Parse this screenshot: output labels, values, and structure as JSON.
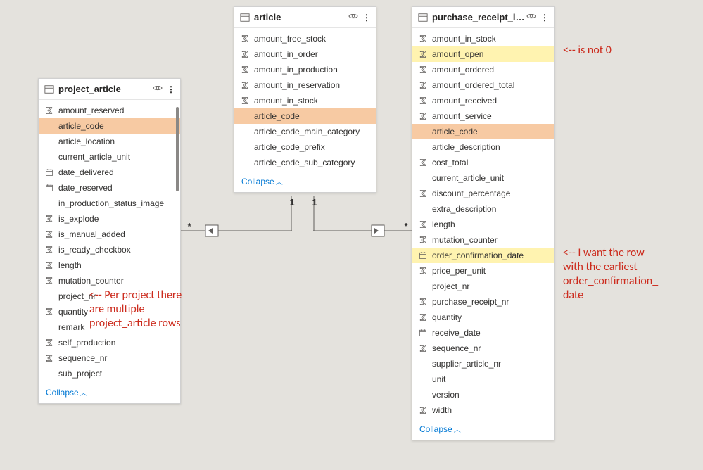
{
  "tables": {
    "project_article": {
      "title": "project_article",
      "collapse": "Collapse",
      "fields": [
        {
          "icon": "sum",
          "label": "amount_reserved",
          "hl": null
        },
        {
          "icon": "none",
          "label": "article_code",
          "hl": "orange"
        },
        {
          "icon": "none",
          "label": "article_location",
          "hl": null
        },
        {
          "icon": "none",
          "label": "current_article_unit",
          "hl": null
        },
        {
          "icon": "date",
          "label": "date_delivered",
          "hl": null
        },
        {
          "icon": "date",
          "label": "date_reserved",
          "hl": null
        },
        {
          "icon": "none",
          "label": "in_production_status_image",
          "hl": null
        },
        {
          "icon": "sum",
          "label": "is_explode",
          "hl": null
        },
        {
          "icon": "sum",
          "label": "is_manual_added",
          "hl": null
        },
        {
          "icon": "sum",
          "label": "is_ready_checkbox",
          "hl": null
        },
        {
          "icon": "sum",
          "label": "length",
          "hl": null
        },
        {
          "icon": "sum",
          "label": "mutation_counter",
          "hl": null
        },
        {
          "icon": "none",
          "label": "project_nr",
          "hl": null
        },
        {
          "icon": "sum",
          "label": "quantity",
          "hl": null
        },
        {
          "icon": "none",
          "label": "remark",
          "hl": null
        },
        {
          "icon": "sum",
          "label": "self_production",
          "hl": null
        },
        {
          "icon": "sum",
          "label": "sequence_nr",
          "hl": null
        },
        {
          "icon": "none",
          "label": "sub_project",
          "hl": null
        }
      ]
    },
    "article": {
      "title": "article",
      "collapse": "Collapse",
      "fields": [
        {
          "icon": "sum",
          "label": "amount_free_stock",
          "hl": null
        },
        {
          "icon": "sum",
          "label": "amount_in_order",
          "hl": null
        },
        {
          "icon": "sum",
          "label": "amount_in_production",
          "hl": null
        },
        {
          "icon": "sum",
          "label": "amount_in_reservation",
          "hl": null
        },
        {
          "icon": "sum",
          "label": "amount_in_stock",
          "hl": null
        },
        {
          "icon": "none",
          "label": "article_code",
          "hl": "orange"
        },
        {
          "icon": "none",
          "label": "article_code_main_category",
          "hl": null
        },
        {
          "icon": "none",
          "label": "article_code_prefix",
          "hl": null
        },
        {
          "icon": "none",
          "label": "article_code_sub_category",
          "hl": null
        }
      ]
    },
    "purchase_receipt_line": {
      "title": "purchase_receipt_line",
      "collapse": "Collapse",
      "fields": [
        {
          "icon": "sum",
          "label": "amount_in_stock",
          "hl": null
        },
        {
          "icon": "sum",
          "label": "amount_open",
          "hl": "yellow"
        },
        {
          "icon": "sum",
          "label": "amount_ordered",
          "hl": null
        },
        {
          "icon": "sum",
          "label": "amount_ordered_total",
          "hl": null
        },
        {
          "icon": "sum",
          "label": "amount_received",
          "hl": null
        },
        {
          "icon": "sum",
          "label": "amount_service",
          "hl": null
        },
        {
          "icon": "none",
          "label": "article_code",
          "hl": "orange"
        },
        {
          "icon": "none",
          "label": "article_description",
          "hl": null
        },
        {
          "icon": "sum",
          "label": "cost_total",
          "hl": null
        },
        {
          "icon": "none",
          "label": "current_article_unit",
          "hl": null
        },
        {
          "icon": "sum",
          "label": "discount_percentage",
          "hl": null
        },
        {
          "icon": "none",
          "label": "extra_description",
          "hl": null
        },
        {
          "icon": "sum",
          "label": "length",
          "hl": null
        },
        {
          "icon": "sum",
          "label": "mutation_counter",
          "hl": null
        },
        {
          "icon": "date",
          "label": "order_confirmation_date",
          "hl": "yellow"
        },
        {
          "icon": "sum",
          "label": "price_per_unit",
          "hl": null
        },
        {
          "icon": "none",
          "label": "project_nr",
          "hl": null
        },
        {
          "icon": "sum",
          "label": "purchase_receipt_nr",
          "hl": null
        },
        {
          "icon": "sum",
          "label": "quantity",
          "hl": null
        },
        {
          "icon": "date",
          "label": "receive_date",
          "hl": null
        },
        {
          "icon": "sum",
          "label": "sequence_nr",
          "hl": null
        },
        {
          "icon": "none",
          "label": "supplier_article_nr",
          "hl": null
        },
        {
          "icon": "none",
          "label": "unit",
          "hl": null
        },
        {
          "icon": "none",
          "label": "version",
          "hl": null
        },
        {
          "icon": "sum",
          "label": "width",
          "hl": null
        }
      ]
    }
  },
  "annotations": {
    "amount_open": "<-- is not 0",
    "project_article": "<-- Per project there\nare multiple\nproject_article rows",
    "order_confirmation_date": "<-- I want the row\nwith the earliest\norder_confirmation_\ndate"
  },
  "cardinalities": {
    "left_star": "*",
    "left_one": "1",
    "right_one": "1",
    "right_star": "*"
  }
}
